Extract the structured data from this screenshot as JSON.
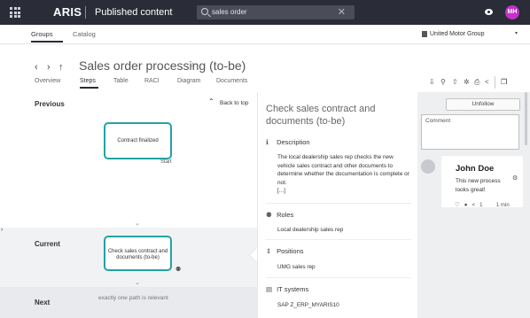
{
  "topbar": {
    "logo": "ARIS",
    "title": "Published content",
    "search_value": "sales order",
    "search_clear": "✕",
    "avatar_initials": "MH",
    "avatar_color": "#c431c8",
    "bg_color": "#2a2c37"
  },
  "nav2": {
    "groups_label": "Groups",
    "catalog_label": "Catalog",
    "group_name": "United Motor Group",
    "group_caret": "▾"
  },
  "header": {
    "back": "‹",
    "forward": "›",
    "up": "↑",
    "title": "Sales order processing (to-be)",
    "star": "☆"
  },
  "tabs": [
    {
      "label": "Overview",
      "active": false
    },
    {
      "label": "Steps",
      "active": true
    },
    {
      "label": "Table",
      "active": false
    },
    {
      "label": "RACI",
      "active": false
    },
    {
      "label": "Diagram",
      "active": false
    },
    {
      "label": "Documents",
      "active": false
    }
  ],
  "toolbar_icons": [
    "download-icon",
    "pin-icon",
    "share-icon",
    "settings-icon",
    "print-icon",
    "share-nodes-icon",
    "pages-icon"
  ],
  "steps": {
    "previous_label": "Previous",
    "back_to_top": "Back to top",
    "previous_card": "Contract finalized",
    "start_label": "Start",
    "current_label": "Current",
    "current_card": "Check sales contract and documents (to-be)",
    "next_label": "Next",
    "next_text": "exactly one path is relevant",
    "accent_color": "#23a3a3"
  },
  "detail": {
    "title": "Check sales contract and documents (to-be)",
    "description_label": "Description",
    "description_text": "The local dealership sales rep checks the new vehicle sales contract and other documents to determine whether the documentation is complete or not.",
    "description_more": "[...]",
    "roles_label": "Roles",
    "roles_value": "Local dealership sales rep",
    "positions_label": "Positions",
    "positions_value": "UMG sales rep",
    "it_label": "IT systems",
    "it_value": "SAP Z_ERP_MYARIS10"
  },
  "comments": {
    "unfollow_label": "Unfollow",
    "comment_placeholder": "Comment",
    "author": "John Doe",
    "text": "This new process looks great!",
    "likes": "1",
    "time": "1 min"
  }
}
